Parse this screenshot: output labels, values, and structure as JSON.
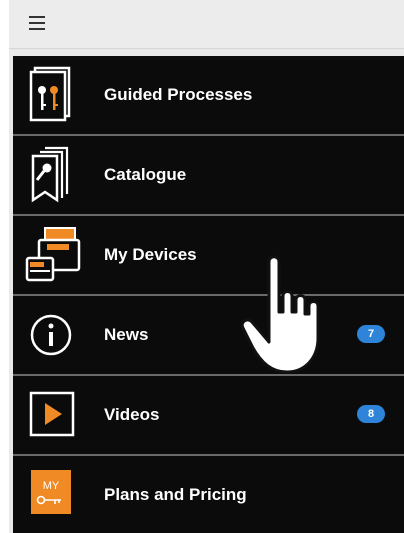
{
  "topbar": {
    "menu_icon": "hamburger-menu-icon"
  },
  "menu": {
    "items": [
      {
        "label": "Guided Processes",
        "icon": "keys-book-icon",
        "badge": null
      },
      {
        "label": "Catalogue",
        "icon": "catalogue-key-icon",
        "badge": null
      },
      {
        "label": "My Devices",
        "icon": "devices-icon",
        "badge": null
      },
      {
        "label": "News",
        "icon": "info-icon",
        "badge": "7"
      },
      {
        "label": "Videos",
        "icon": "play-icon",
        "badge": "8"
      },
      {
        "label": "Plans and Pricing",
        "icon": "my-key-icon",
        "icon_text": "MY",
        "badge": null
      }
    ]
  },
  "overlay": {
    "icon": "pointing-hand-icon"
  },
  "colors": {
    "menu_bg": "#0b0b0b",
    "accent_orange": "#f08a24",
    "badge_blue": "#2d84d8",
    "divider": "#6a6a6a"
  }
}
